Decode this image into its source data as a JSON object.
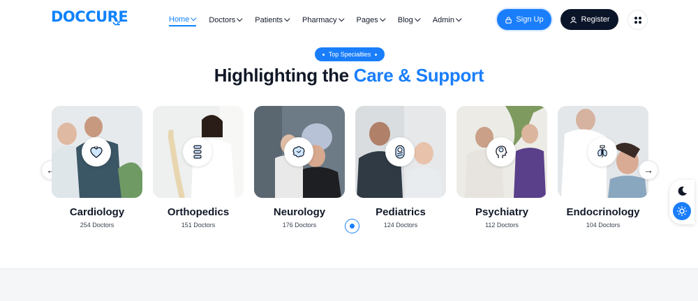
{
  "logo": {
    "text": "DOCCURE"
  },
  "nav": {
    "items": [
      {
        "label": "Home",
        "active": true
      },
      {
        "label": "Doctors",
        "active": false
      },
      {
        "label": "Patients",
        "active": false
      },
      {
        "label": "Pharmacy",
        "active": false
      },
      {
        "label": "Pages",
        "active": false
      },
      {
        "label": "Blog",
        "active": false
      },
      {
        "label": "Admin",
        "active": false
      }
    ]
  },
  "header": {
    "signup_label": "Sign Up",
    "register_label": "Register"
  },
  "section": {
    "badge": "Top Specialties",
    "title_main": "Highlighting the",
    "title_accent": "Care & Support"
  },
  "specialties": [
    {
      "name": "Cardiology",
      "count": "254 Doctors",
      "icon": "heart-icon"
    },
    {
      "name": "Orthopedics",
      "count": "151 Doctors",
      "icon": "spine-icon"
    },
    {
      "name": "Neurology",
      "count": "176 Doctors",
      "icon": "brain-icon"
    },
    {
      "name": "Pediatrics",
      "count": "124 Doctors",
      "icon": "baby-icon"
    },
    {
      "name": "Psychiatry",
      "count": "112 Doctors",
      "icon": "mind-icon"
    },
    {
      "name": "Endocrinology",
      "count": "104 Doctors",
      "icon": "thyroid-icon"
    }
  ],
  "colors": {
    "accent": "#1a7efb",
    "dark": "#0b1529",
    "text": "#111827"
  }
}
